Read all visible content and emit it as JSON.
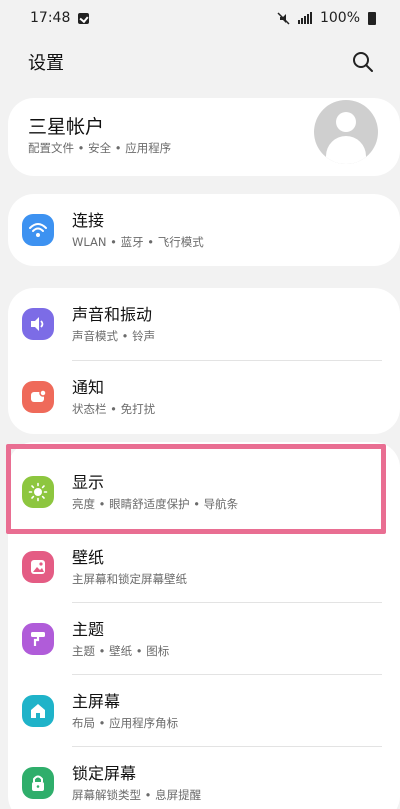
{
  "status": {
    "time": "17:48",
    "battery": "100%"
  },
  "header": {
    "title": "设置"
  },
  "account": {
    "title": "三星帐户",
    "subtitle": "配置文件 • 安全 • 应用程序"
  },
  "items": [
    {
      "id": "connections",
      "title": "连接",
      "subtitle": "WLAN • 蓝牙 • 飞行模式",
      "color": "#3d92f1",
      "icon": "wifi-icon"
    },
    {
      "id": "sound",
      "title": "声音和振动",
      "subtitle": "声音模式 • 铃声",
      "color": "#7c6ce6",
      "icon": "speaker-icon"
    },
    {
      "id": "notifications",
      "title": "通知",
      "subtitle": "状态栏 • 免打扰",
      "color": "#ef6a5a",
      "icon": "notification-icon"
    },
    {
      "id": "display",
      "title": "显示",
      "subtitle": "亮度 • 眼睛舒适度保护 • 导航条",
      "color": "#8dc63f",
      "icon": "sun-icon"
    },
    {
      "id": "wallpaper",
      "title": "壁纸",
      "subtitle": "主屏幕和锁定屏幕壁纸",
      "color": "#e45c84",
      "icon": "image-icon"
    },
    {
      "id": "themes",
      "title": "主题",
      "subtitle": "主题 • 壁纸 • 图标",
      "color": "#b05cd9",
      "icon": "paint-roller-icon"
    },
    {
      "id": "home",
      "title": "主屏幕",
      "subtitle": "布局 • 应用程序角标",
      "color": "#1fb3c9",
      "icon": "home-icon"
    },
    {
      "id": "lock",
      "title": "锁定屏幕",
      "subtitle": "屏幕解锁类型 • 息屏提醒",
      "color": "#2fae6b",
      "icon": "lock-icon"
    }
  ]
}
